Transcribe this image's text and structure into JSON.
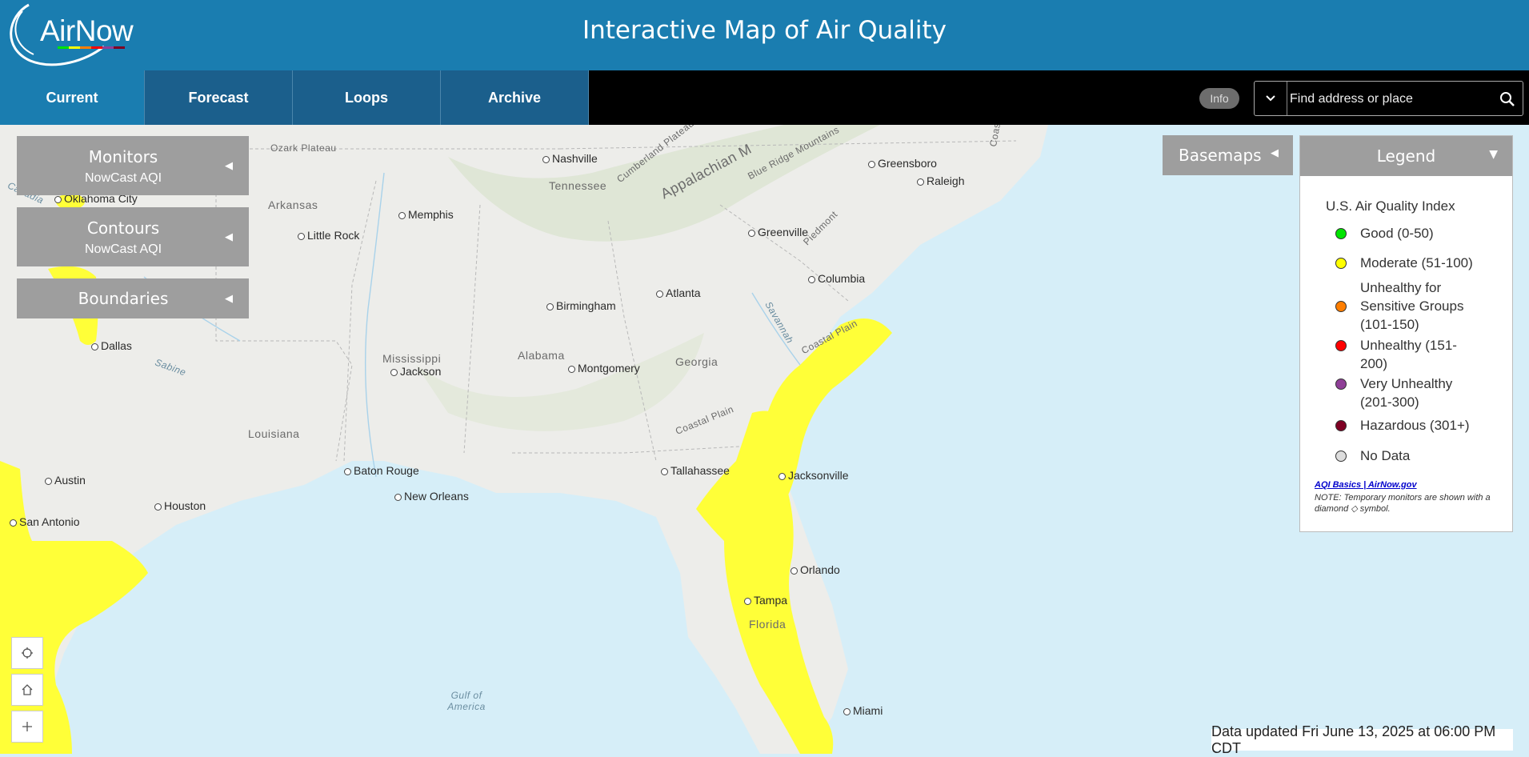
{
  "header": {
    "logo_text": "AirNow",
    "title": "Interactive Map of Air Quality"
  },
  "nav": {
    "tabs": [
      "Current",
      "Forecast",
      "Loops",
      "Archive"
    ],
    "active": "Current"
  },
  "info_label": "Info",
  "search": {
    "placeholder": "Find address or place"
  },
  "panels": [
    {
      "title": "Monitors",
      "subtitle": "NowCast AQI"
    },
    {
      "title": "Contours",
      "subtitle": "NowCast AQI"
    },
    {
      "title": "Boundaries",
      "subtitle": ""
    }
  ],
  "basemaps_label": "Basemaps",
  "legend": {
    "header": "Legend",
    "title": "U.S. Air Quality Index",
    "items": [
      {
        "label": "Good (0-50)",
        "color": "#00e400"
      },
      {
        "label": "Moderate (51-100)",
        "color": "#ffff00"
      },
      {
        "label": "Unhealthy for Sensitive Groups (101-150)",
        "color": "#ff7e00"
      },
      {
        "label": "Unhealthy (151-200)",
        "color": "#ff0000"
      },
      {
        "label": "Very Unhealthy (201-300)",
        "color": "#8f3f97"
      },
      {
        "label": "Hazardous (301+)",
        "color": "#7e0023"
      },
      {
        "label": "No Data",
        "color": "#dddddd"
      }
    ],
    "link": "AQI Basics | AirNow.gov",
    "note": "NOTE: Temporary monitors are shown with a diamond ◇ symbol."
  },
  "updated": "Data updated Fri June 13, 2025 at 06:00 PM CDT",
  "map": {
    "cities": [
      "Nashville",
      "Greensboro",
      "Raleigh",
      "Memphis",
      "Little Rock",
      "Greenville",
      "Columbia",
      "Atlanta",
      "Birmingham",
      "Dallas",
      "Jackson",
      "Montgomery",
      "Austin",
      "Baton Rouge",
      "New Orleans",
      "Tallahassee",
      "Jacksonville",
      "Houston",
      "San Antonio",
      "Orlando",
      "Tampa",
      "Miami",
      "Oklahoma City"
    ],
    "regions": [
      "Ozark Plateau",
      "Tennessee",
      "Arkansas",
      "Mississippi",
      "Alabama",
      "Georgia",
      "Louisiana",
      "Florida",
      "Coastal Plain",
      "Coastal Plain",
      "Appalachian M",
      "Blue Ridge Mountains",
      "Cumberland Plateau",
      "Piedmont",
      "Savannah",
      "Sabine",
      "Gulf of America",
      "Coasta",
      "Canadia"
    ]
  }
}
